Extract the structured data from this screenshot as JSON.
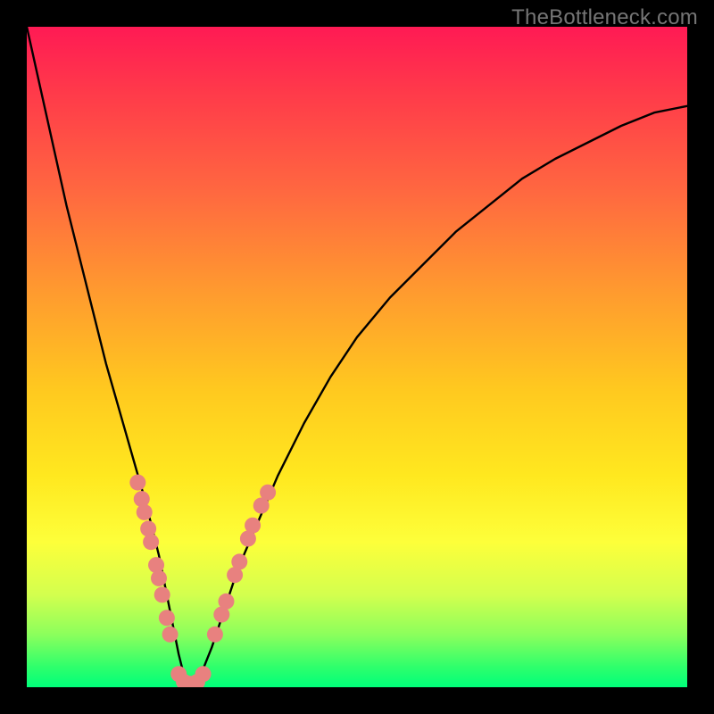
{
  "watermark": "TheBottleneck.com",
  "colors": {
    "background": "#000000",
    "curve": "#000000",
    "dots": "#e8817f"
  },
  "chart_data": {
    "type": "line",
    "title": "",
    "xlabel": "",
    "ylabel": "",
    "xlim": [
      0,
      100
    ],
    "ylim": [
      0,
      100
    ],
    "series": [
      {
        "name": "bottleneck-curve",
        "x": [
          0,
          2,
          4,
          6,
          8,
          10,
          12,
          14,
          16,
          18,
          20,
          21,
          22,
          23,
          24,
          25,
          26,
          28,
          30,
          32,
          35,
          38,
          42,
          46,
          50,
          55,
          60,
          65,
          70,
          75,
          80,
          85,
          90,
          95,
          100
        ],
        "y": [
          100,
          91,
          82,
          73,
          65,
          57,
          49,
          42,
          35,
          28,
          20,
          15,
          10,
          5,
          1,
          0,
          1,
          6,
          12,
          18,
          25,
          32,
          40,
          47,
          53,
          59,
          64,
          69,
          73,
          77,
          80,
          82.5,
          85,
          87,
          88
        ]
      }
    ],
    "highlight_points": {
      "name": "highlighted-range",
      "points": [
        {
          "x": 16.8,
          "y": 31
        },
        {
          "x": 17.4,
          "y": 28.5
        },
        {
          "x": 17.8,
          "y": 26.5
        },
        {
          "x": 18.4,
          "y": 24
        },
        {
          "x": 18.8,
          "y": 22
        },
        {
          "x": 19.6,
          "y": 18.5
        },
        {
          "x": 20.0,
          "y": 16.5
        },
        {
          "x": 20.5,
          "y": 14
        },
        {
          "x": 21.2,
          "y": 10.5
        },
        {
          "x": 21.7,
          "y": 8
        },
        {
          "x": 23.0,
          "y": 2
        },
        {
          "x": 23.8,
          "y": 0.8
        },
        {
          "x": 24.8,
          "y": 0.5
        },
        {
          "x": 25.8,
          "y": 0.8
        },
        {
          "x": 26.7,
          "y": 2
        },
        {
          "x": 28.5,
          "y": 8
        },
        {
          "x": 29.5,
          "y": 11
        },
        {
          "x": 30.2,
          "y": 13
        },
        {
          "x": 31.5,
          "y": 17
        },
        {
          "x": 32.2,
          "y": 19
        },
        {
          "x": 33.5,
          "y": 22.5
        },
        {
          "x": 34.2,
          "y": 24.5
        },
        {
          "x": 35.5,
          "y": 27.5
        },
        {
          "x": 36.5,
          "y": 29.5
        }
      ]
    }
  }
}
